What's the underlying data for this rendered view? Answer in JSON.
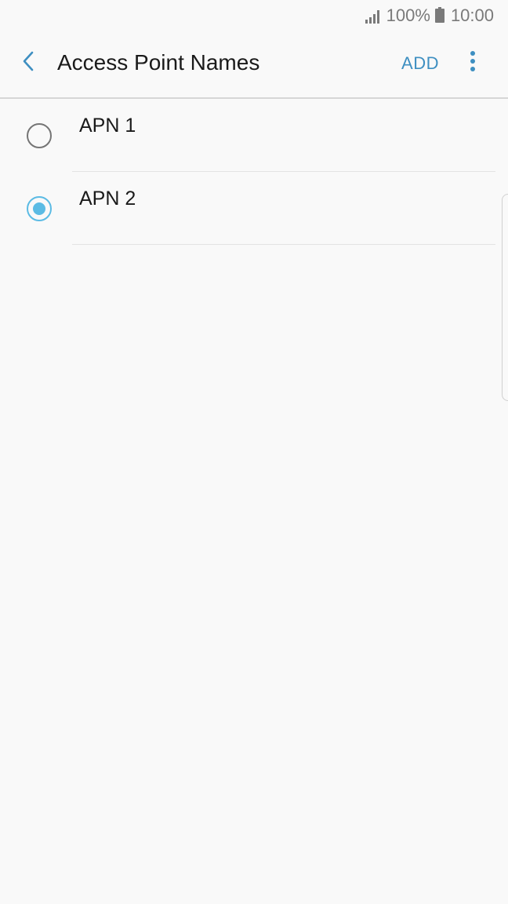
{
  "status_bar": {
    "signal_icon": "signal-icon",
    "battery_level": "100%",
    "battery_icon": "battery-icon",
    "time": "10:00"
  },
  "app_bar": {
    "back_icon": "chevron-left-icon",
    "title": "Access Point Names",
    "add_label": "ADD",
    "more_icon": "more-vertical-icon"
  },
  "apn_list": {
    "items": [
      {
        "label": "APN 1",
        "selected": false
      },
      {
        "label": "APN 2",
        "selected": true
      }
    ]
  },
  "colors": {
    "accent": "#3e8fc1",
    "radio_selected": "#5bbbe4",
    "radio_unselected": "#757575",
    "background": "#f9f9f9"
  }
}
